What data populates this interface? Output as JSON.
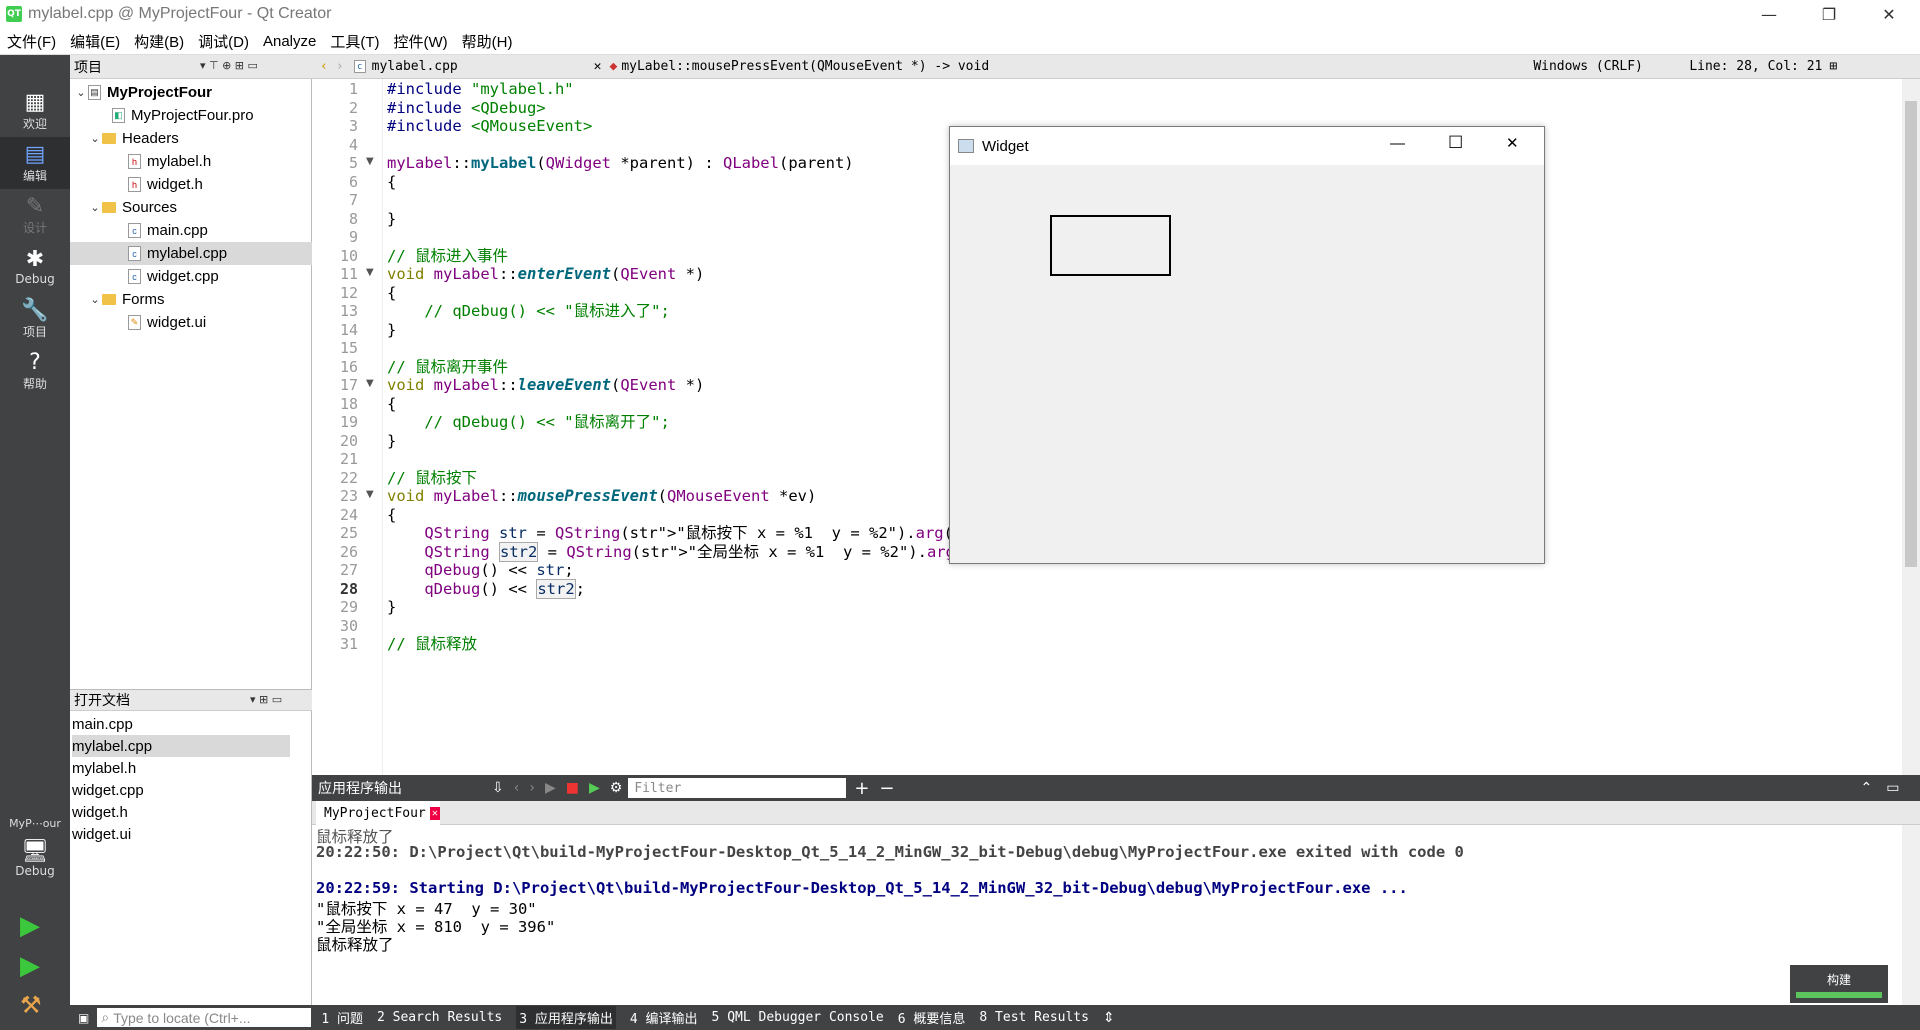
{
  "window": {
    "title": "mylabel.cpp @ MyProjectFour - Qt Creator",
    "logo": "QT",
    "min": "—",
    "max": "❐",
    "close": "✕"
  },
  "menu": [
    "文件(F)",
    "编辑(E)",
    "构建(B)",
    "调试(D)",
    "Analyze",
    "工具(T)",
    "控件(W)",
    "帮助(H)"
  ],
  "modes": [
    {
      "label": "欢迎",
      "icon": "grid-icon"
    },
    {
      "label": "编辑",
      "icon": "edit-icon"
    },
    {
      "label": "设计",
      "icon": "pen-icon"
    },
    {
      "label": "Debug",
      "icon": "bug-icon"
    },
    {
      "label": "项目",
      "icon": "wrench-icon"
    },
    {
      "label": "帮助",
      "icon": "help-icon"
    }
  ],
  "kit": {
    "project": "MyP⋯our",
    "mode": "Debug"
  },
  "project_panel": {
    "title": "项目"
  },
  "tree": [
    {
      "label": "MyProjectFour",
      "level": 0,
      "kind": "project"
    },
    {
      "label": "MyProjectFour.pro",
      "level": 1,
      "kind": "pro"
    },
    {
      "label": "Headers",
      "level": 1,
      "kind": "folder"
    },
    {
      "label": "mylabel.h",
      "level": 2,
      "kind": "h"
    },
    {
      "label": "widget.h",
      "level": 2,
      "kind": "h"
    },
    {
      "label": "Sources",
      "level": 1,
      "kind": "folder"
    },
    {
      "label": "main.cpp",
      "level": 2,
      "kind": "cpp"
    },
    {
      "label": "mylabel.cpp",
      "level": 2,
      "kind": "cpp",
      "selected": true
    },
    {
      "label": "widget.cpp",
      "level": 2,
      "kind": "cpp"
    },
    {
      "label": "Forms",
      "level": 1,
      "kind": "folder"
    },
    {
      "label": "widget.ui",
      "level": 2,
      "kind": "ui"
    }
  ],
  "open_docs": {
    "title": "打开文档",
    "items": [
      "main.cpp",
      "mylabel.cpp",
      "mylabel.h",
      "widget.cpp",
      "widget.h",
      "widget.ui"
    ],
    "selected": "mylabel.cpp"
  },
  "editor": {
    "file": "mylabel.cpp",
    "symbol": "myLabel::mousePressEvent(QMouseEvent *) -> void",
    "encoding": "Windows (CRLF)",
    "position": "Line: 28, Col: 21",
    "current_line": 28
  },
  "code": [
    "#include \"mylabel.h\"",
    "#include <QDebug>",
    "#include <QMouseEvent>",
    "",
    "myLabel::myLabel(QWidget *parent) : QLabel(parent)",
    "{",
    "",
    "}",
    "",
    "// 鼠标进入事件",
    "void myLabel::enterEvent(QEvent *)",
    "{",
    "    // qDebug() << \"鼠标进入了\";",
    "}",
    "",
    "// 鼠标离开事件",
    "void myLabel::leaveEvent(QEvent *)",
    "{",
    "    // qDebug() << \"鼠标离开了\";",
    "}",
    "",
    "// 鼠标按下",
    "void myLabel::mousePressEvent(QMouseEvent *ev)",
    "{",
    "    QString str = QString(\"鼠标按下 x = %1  y = %2\").arg(ev->x()).arg(ev->y());",
    "    QString str2 = QString(\"全局坐标 x = %1  y = %2\").arg(ev->globalX()).arg(ev->globalY());",
    "    qDebug() << str;",
    "    qDebug() << str2;",
    "}",
    "",
    "// 鼠标释放"
  ],
  "widget_window": {
    "title": "Widget"
  },
  "output_panel": {
    "title": "应用程序输出",
    "filter_placeholder": "Filter",
    "tab": "MyProjectFour",
    "lines": [
      {
        "text": "鼠标释放了",
        "style": "grey"
      },
      {
        "text": "20:22:50: D:\\Project\\Qt\\build-MyProjectFour-Desktop_Qt_5_14_2_MinGW_32_bit-Debug\\debug\\MyProjectFour.exe exited with code 0",
        "style": "bold"
      },
      {
        "text": "",
        "style": "normal"
      },
      {
        "text": "20:22:59: Starting D:\\Project\\Qt\\build-MyProjectFour-Desktop_Qt_5_14_2_MinGW_32_bit-Debug\\debug\\MyProjectFour.exe ...",
        "style": "blue"
      },
      {
        "text": "\"鼠标按下 x = 47  y = 30\"",
        "style": "normal"
      },
      {
        "text": "\"全局坐标 x = 810  y = 396\"",
        "style": "normal"
      },
      {
        "text": "鼠标释放了",
        "style": "normal"
      }
    ]
  },
  "build_badge": "构建",
  "status": {
    "locator_placeholder": "Type to locate (Ctrl+...",
    "tabs": [
      "1 问题",
      "2 Search Results",
      "3 应用程序输出",
      "4 编译输出",
      "5 QML Debugger Console",
      "6 概要信息",
      "8 Test Results"
    ]
  }
}
